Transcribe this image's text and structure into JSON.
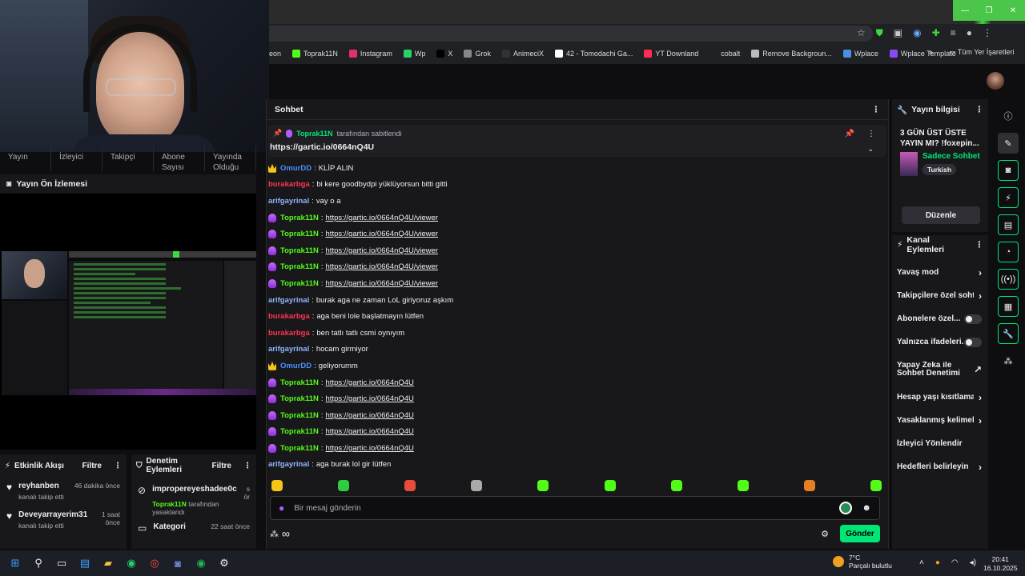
{
  "browser": {
    "bookmarks": [
      {
        "label": "eon",
        "color": "#000000"
      },
      {
        "label": "Toprak11N",
        "color": "#53fc18"
      },
      {
        "label": "Instagram",
        "color": "#e1306c"
      },
      {
        "label": "Wp",
        "color": "#25d366"
      },
      {
        "label": "X",
        "color": "#000000"
      },
      {
        "label": "Grok",
        "color": "#888888"
      },
      {
        "label": "AnimeciX",
        "color": "#333333"
      },
      {
        "label": "42 - Tomodachi Ga...",
        "color": "#ffffff"
      },
      {
        "label": "YT Downland",
        "color": "#ff2d55"
      },
      {
        "label": "cobalt",
        "color": "#222222"
      },
      {
        "label": "Remove Backgroun...",
        "color": "#bbbbbb"
      },
      {
        "label": "Wplace",
        "color": "#4a90e2"
      },
      {
        "label": "Wplace Template",
        "color": "#8a4af3"
      }
    ],
    "all_bookmarks": "Tüm Yer İşaretleri"
  },
  "left": {
    "stats": [
      "Yayın",
      "İzleyici",
      "Takipçi",
      "Abone Sayısı",
      "Yayında Olduğu Sü"
    ],
    "preview_title": "Yayın Ön İzlemesi",
    "activity": {
      "title": "Etkinlik Akışı",
      "filter": "Filtre",
      "items": [
        {
          "name": "reyhanben",
          "sub": "kanalı takip etti",
          "time": "46 dakika önce"
        },
        {
          "name": "Deveyarrayerim31",
          "sub": "kanalı takip etti",
          "time": "1 saat önce"
        }
      ]
    },
    "moderation": {
      "title": "Denetim Eylemleri",
      "filter": "Filtre",
      "items": [
        {
          "name": "improperey­eshadee0cp",
          "suffix": "s ör",
          "by_user": "Toprak11N",
          "by_text": "tarafından yasaklandı"
        },
        {
          "name": "Kategori",
          "time": "22 saat önce"
        }
      ]
    }
  },
  "chat": {
    "title": "Sohbet",
    "pinned": {
      "by_user": "Toprak11N",
      "by_text": "tarafından sabitlendi",
      "link": "https://gartic.io/0664nQ4U"
    },
    "messages": [
      {
        "badge": "crown",
        "user": "OmurDD",
        "color": "#4a90ff",
        "text": "KLİP ALIN",
        "link": ""
      },
      {
        "badge": "",
        "user": "burakarbga",
        "color": "#ff3355",
        "text": "bi kere goodbydpi yüklüyorsun bitti gitti",
        "link": ""
      },
      {
        "badge": "",
        "user": "arifgayrinal",
        "color": "#8fb5ff",
        "text": "vay o a",
        "link": ""
      },
      {
        "badge": "mic",
        "user": "Toprak11N",
        "color": "#53fc18",
        "text": "",
        "link": "https://gartic.io/0664nQ4U/viewer"
      },
      {
        "badge": "mic",
        "user": "Toprak11N",
        "color": "#53fc18",
        "text": "",
        "link": "https://gartic.io/0664nQ4U/viewer"
      },
      {
        "badge": "mic",
        "user": "Toprak11N",
        "color": "#53fc18",
        "text": "",
        "link": "https://gartic.io/0664nQ4U/viewer"
      },
      {
        "badge": "mic",
        "user": "Toprak11N",
        "color": "#53fc18",
        "text": "",
        "link": "https://gartic.io/0664nQ4U/viewer"
      },
      {
        "badge": "mic",
        "user": "Toprak11N",
        "color": "#53fc18",
        "text": "",
        "link": "https://gartic.io/0664nQ4U/viewer"
      },
      {
        "badge": "",
        "user": "arifgayrinal",
        "color": "#8fb5ff",
        "text": "burak aga ne zaman LoL giriyoruz aşkım",
        "link": ""
      },
      {
        "badge": "",
        "user": "burakarbga",
        "color": "#ff3355",
        "text": "aga beni lole başlatmayın lütfen",
        "link": ""
      },
      {
        "badge": "",
        "user": "burakarbga",
        "color": "#ff3355",
        "text": "ben tatlı tatlı csmi oynıyım",
        "link": ""
      },
      {
        "badge": "",
        "user": "arifgayrinal",
        "color": "#8fb5ff",
        "text": "hocam girmiyor",
        "link": ""
      },
      {
        "badge": "crown",
        "user": "OmurDD",
        "color": "#4a90ff",
        "text": "geliyorumm",
        "link": ""
      },
      {
        "badge": "mic",
        "user": "Toprak11N",
        "color": "#53fc18",
        "text": "",
        "link": "https://gartic.io/0664nQ4U"
      },
      {
        "badge": "mic",
        "user": "Toprak11N",
        "color": "#53fc18",
        "text": "",
        "link": "https://gartic.io/0664nQ4U"
      },
      {
        "badge": "mic",
        "user": "Toprak11N",
        "color": "#53fc18",
        "text": "",
        "link": "https://gartic.io/0664nQ4U"
      },
      {
        "badge": "mic",
        "user": "Toprak11N",
        "color": "#53fc18",
        "text": "",
        "link": "https://gartic.io/0664nQ4U"
      },
      {
        "badge": "mic",
        "user": "Toprak11N",
        "color": "#53fc18",
        "text": "",
        "link": "https://gartic.io/0664nQ4U"
      },
      {
        "badge": "",
        "user": "arifgayrinal",
        "color": "#8fb5ff",
        "text": "aga burak lol gir lütfen",
        "link": ""
      }
    ],
    "emote_colors": [
      "#f5c518",
      "#2ecc40",
      "#e74c3c",
      "#aaaaaa",
      "#53fc18",
      "#53fc18",
      "#53fc18",
      "#53fc18",
      "#e67e22",
      "#53fc18"
    ],
    "input_placeholder": "Bir mesaj gönderin",
    "send_label": "Gönder"
  },
  "right": {
    "stream_info": {
      "title": "Yayın bilgisi",
      "stream_title": "3 GÜN ÜST ÜSTE YAYIN MI? !foxepin...",
      "category": "Sadece Sohbet",
      "tag": "Turkish",
      "edit_label": "Düzenle"
    },
    "channel_actions": {
      "title": "Kanal Eylemleri",
      "items": [
        {
          "label": "Yavaş mod",
          "control": "chevron"
        },
        {
          "label": "Takipçilere özel soht",
          "control": "chevron"
        },
        {
          "label": "Abonelere özel...",
          "control": "toggle"
        },
        {
          "label": "Yalnızca ifadeleri...",
          "control": "toggle"
        },
        {
          "label": "Yapay Zeka ile Sohbet Denetimi",
          "control": "external"
        },
        {
          "label": "Hesap yaşı kısıtlama",
          "control": "chevron"
        },
        {
          "label": "Yasaklanmış kelimele",
          "control": "chevron"
        },
        {
          "label": "İzleyici Yönlendir",
          "control": "none"
        },
        {
          "label": "Hedefleri belirleyin",
          "control": "chevron"
        }
      ]
    }
  },
  "taskbar": {
    "weather_temp": "7°C",
    "weather_desc": "Parçalı bulutlu",
    "time": "20:41",
    "date": "16.10.2025"
  }
}
